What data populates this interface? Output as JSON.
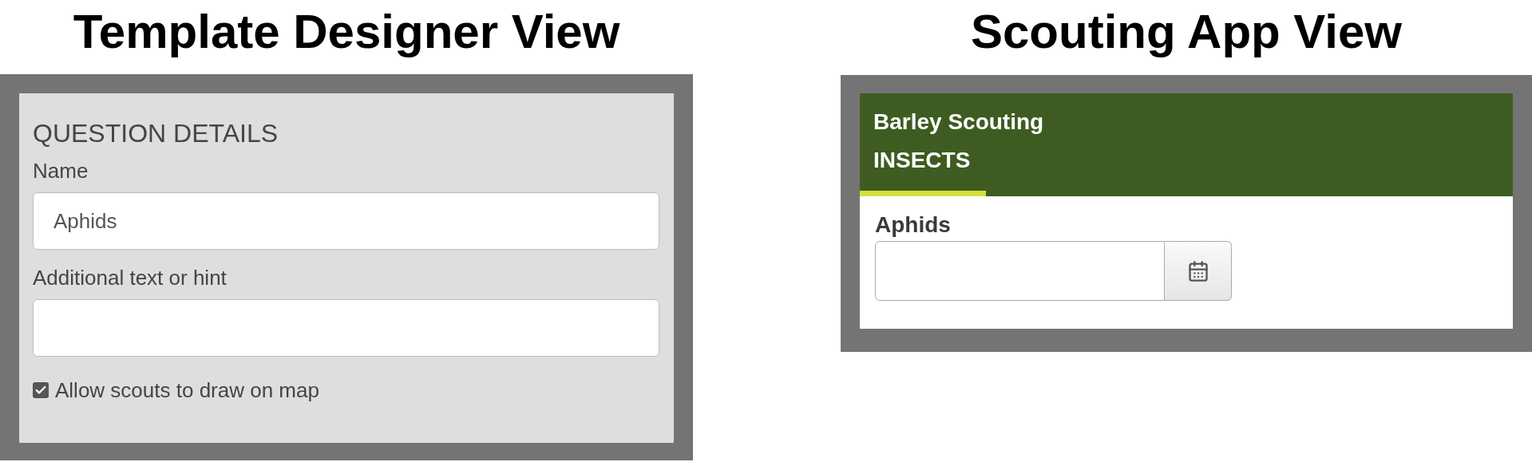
{
  "left": {
    "title": "Template Designer View",
    "section_title": "QUESTION DETAILS",
    "fields": [
      {
        "label": "Name",
        "value": "Aphids"
      },
      {
        "label": "Additional text or hint"
      }
    ],
    "checkbox": {
      "label": "Allow scouts to draw on map",
      "checked": true
    }
  },
  "right": {
    "title": "Scouting App View",
    "app_title": "Barley Scouting",
    "tabs": [
      {
        "label": "INSECTS",
        "selected": true
      }
    ],
    "question": {
      "label": "Aphids"
    }
  }
}
